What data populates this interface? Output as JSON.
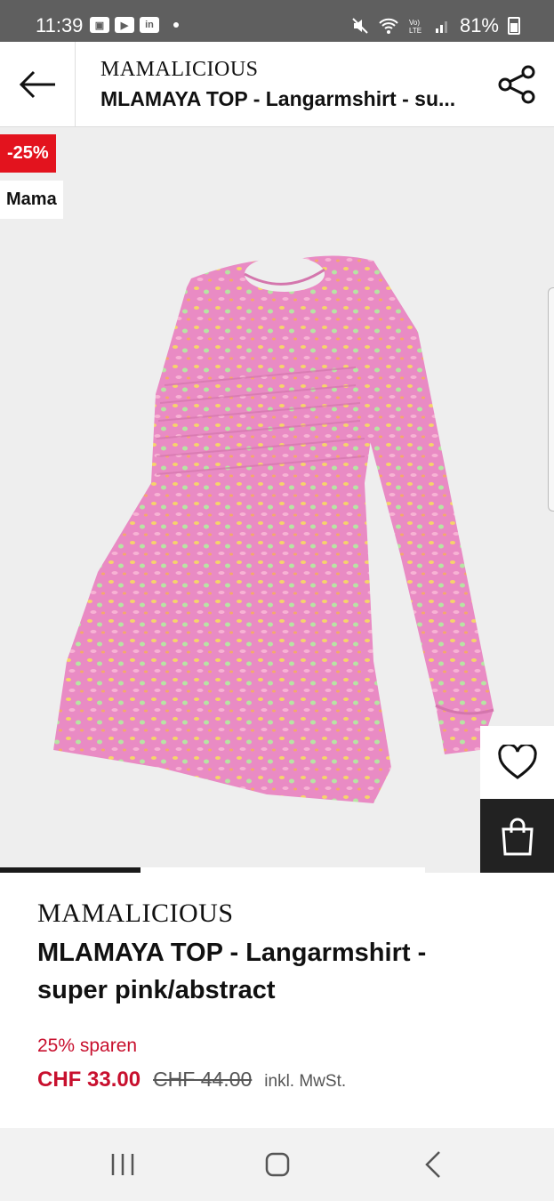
{
  "status_bar": {
    "time": "11:39",
    "notification_icons": [
      "app-notification-icon",
      "youtube-icon",
      "linkedin-icon"
    ],
    "battery": "81%"
  },
  "header": {
    "brand": "MAMALICIOUS",
    "title": "MLAMAYA TOP - Langarmshirt - su..."
  },
  "badges": {
    "discount": "-25%",
    "category": "Mama"
  },
  "gallery": {
    "current_image_fraction": 0.33
  },
  "product": {
    "brand": "MAMALICIOUS",
    "name": "MLAMAYA TOP - Langarmshirt - super pink/abstract",
    "savings": "25% sparen",
    "price": "CHF 33.00",
    "original_price": "CHF 44.00",
    "tax_note": "inkl. MwSt."
  },
  "colors": {
    "sale_red": "#e3131e",
    "price_red": "#c8102e",
    "status_bar": "#5f5f5f",
    "product_pink": "#e98bc4"
  }
}
